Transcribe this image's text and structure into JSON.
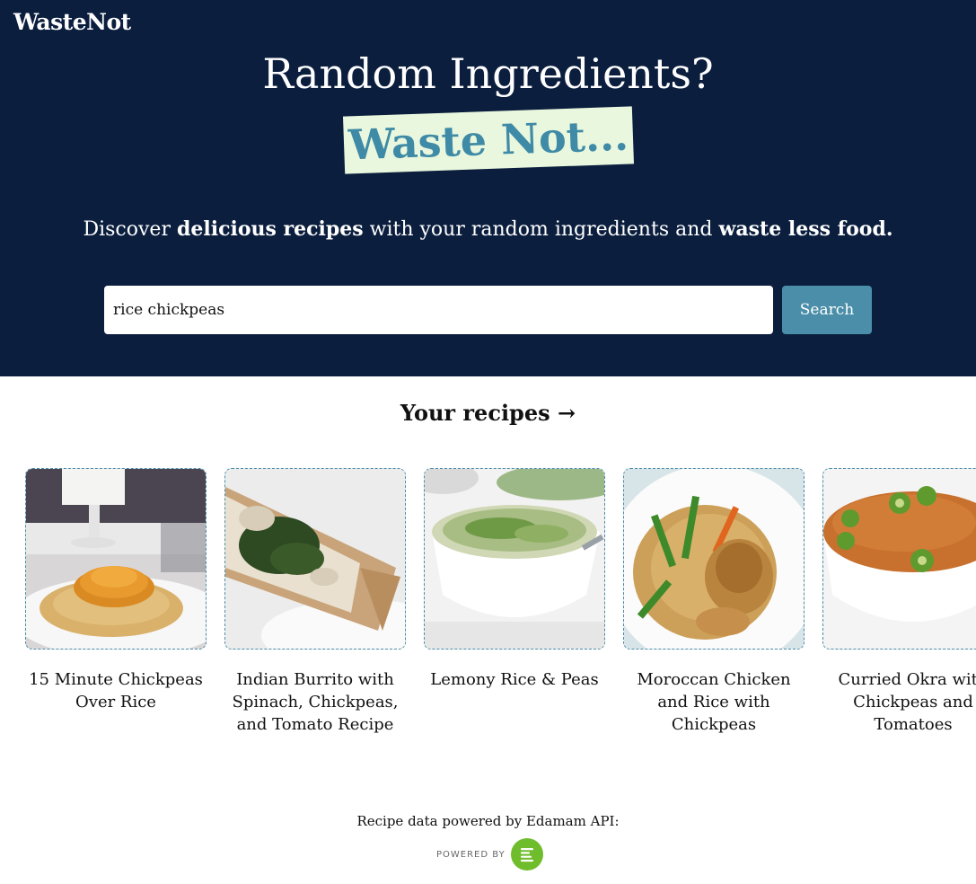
{
  "brand": "WasteNot",
  "hero": {
    "headline": "Random Ingredients?",
    "badge": "Waste Not...",
    "tagline": {
      "part1": "Discover ",
      "bold1": "delicious recipes",
      "part2": " with your random ingredients and ",
      "bold2": "waste less food."
    }
  },
  "search": {
    "value": "rice chickpeas",
    "button_label": "Search"
  },
  "results": {
    "title": "Your recipes →",
    "recipes": [
      {
        "title": "15 Minute Chickpeas Over Rice",
        "image": "chickpeas-rice-photo"
      },
      {
        "title": "Indian Burrito with Spinach, Chickpeas, and Tomato Recipe",
        "image": "burrito-photo"
      },
      {
        "title": "Lemony Rice & Peas",
        "image": "rice-peas-bowl-photo"
      },
      {
        "title": "Moroccan Chicken and Rice with Chickpeas",
        "image": "chicken-rice-photo"
      },
      {
        "title": "Curried Okra with Chickpeas and Tomatoes",
        "image": "curried-okra-photo"
      }
    ]
  },
  "footer": {
    "text": "Recipe data powered by Edamam API:",
    "powered_by": "POWERED BY",
    "logo": "edamam-logo"
  },
  "colors": {
    "hero_bg": "#0b1e3e",
    "accent": "#4a8ea9",
    "badge_bg": "#e8f7dd",
    "edamam_green": "#6fbd2c"
  }
}
